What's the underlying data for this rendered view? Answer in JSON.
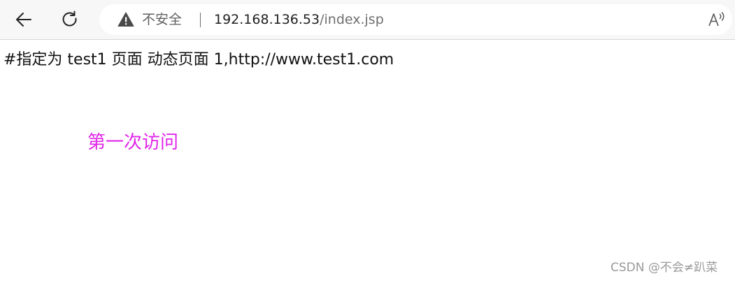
{
  "browser": {
    "security_label": "不安全",
    "url_host": "192.168.136.53",
    "url_path": "/index.jsp",
    "icons": {
      "back": "back-arrow-icon",
      "reload": "reload-icon",
      "warning": "warning-triangle-icon",
      "read_aloud": "read-aloud-icon"
    }
  },
  "page": {
    "header_text": "#指定为 test1 页面 动态页面 1,http://www.test1.com",
    "visit_text": "第一次访问",
    "visit_color": "#e026e8"
  },
  "watermark": {
    "text": "CSDN @不会≠趴菜"
  }
}
